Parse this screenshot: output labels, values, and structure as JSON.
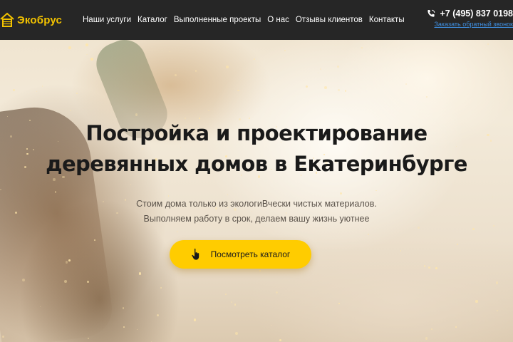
{
  "header": {
    "logo_text": "Экобрус",
    "nav": [
      {
        "label": "Наши услуги"
      },
      {
        "label": "Каталог"
      },
      {
        "label": "Выполненные проекты"
      },
      {
        "label": "О нас"
      },
      {
        "label": "Отзывы клиентов"
      },
      {
        "label": "Контакты"
      }
    ],
    "phone": "+7 (495) 837 0198",
    "callback_label": "Заказать обратный звонок"
  },
  "hero": {
    "title_line1": "Постройка и проектирование",
    "title_line2": "деревянных домов в Екатеринбурге",
    "subtitle_line1": "Стоим дома только из экологиВчески чистых материалов.",
    "subtitle_line2": "Выполняем работу в срок, делаем вашу жизнь уютнее",
    "cta_label": "Посмотреть каталог"
  },
  "colors": {
    "header_bg": "#262626",
    "accent_yellow": "#ffcc00",
    "logo_yellow": "#f2c200",
    "link_blue": "#3f8fe0"
  },
  "icons": {
    "logo": "house-logo-icon",
    "phone": "phone-icon",
    "cta": "pointer-hand-icon"
  }
}
